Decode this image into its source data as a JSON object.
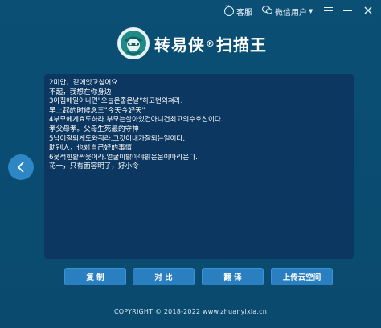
{
  "titlebar": {
    "service_label": "客服",
    "user_label": "微信用户",
    "service_icon": "chat-bubble-icon",
    "user_icon": "wechat-icon"
  },
  "header": {
    "brand_name": "转易侠",
    "brand_mark": "®",
    "brand_suffix": "扫描王"
  },
  "text_panel": {
    "lines": [
      "2미안，같에있고싶어요",
      "不起，我想在你身边",
      "3아침에일어나면\"오늘은좋은날\"하고번외쳐라.",
      "早上起的时候念三\"今天今好天\"",
      "4부모에게효도하라.부모는살아있건아니건최고의수호신이다.",
      "孝父母孝。父母生死最的守神",
      "5남이잘되게도와줘라.그것이내가잘되는일이다.",
      "助别人，也对自己好的事情",
      "6웃적힌활짝웃어라.얼굴이밝아야밝은운이따라온다.",
      "花一，只有面容明了，好小令"
    ]
  },
  "actions": {
    "copy": "复 制",
    "compare": "对 比",
    "translate": "翻 译",
    "upload": "上传云空间"
  },
  "footer": {
    "copyright": "COPYRIGHT © 2018-2022   www.zhuanyixia.cn"
  },
  "colors": {
    "background": "#0b4d72",
    "panel": "#0c3760",
    "button": "#2a7fc0",
    "back_button": "#2e87c4"
  }
}
